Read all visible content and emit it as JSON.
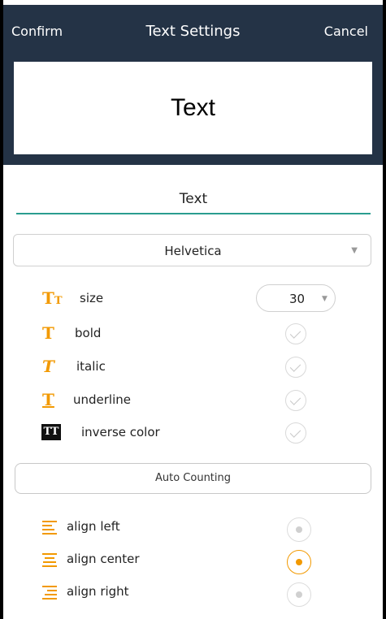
{
  "header": {
    "confirm_label": "Confirm",
    "title": "Text Settings",
    "cancel_label": "Cancel",
    "background_color": "#243346"
  },
  "preview": {
    "text": "Text"
  },
  "text_input": {
    "value": "Text"
  },
  "font_select": {
    "value": "Helvetica"
  },
  "options": {
    "size": {
      "label": "size",
      "value": "30",
      "icon": "text-size-icon"
    },
    "bold": {
      "label": "bold",
      "icon": "bold-icon",
      "checked": false
    },
    "italic": {
      "label": "italic",
      "icon": "italic-icon",
      "checked": false
    },
    "underline": {
      "label": "underline",
      "icon": "underline-icon",
      "checked": false
    },
    "inverse": {
      "label": "inverse color",
      "icon": "inverse-color-icon",
      "checked": false
    }
  },
  "auto_counting": {
    "label": "Auto Counting"
  },
  "alignment": {
    "left": {
      "label": "align left",
      "selected": false
    },
    "center": {
      "label": "align center",
      "selected": true
    },
    "right": {
      "label": "align right",
      "selected": false
    }
  },
  "colors": {
    "accent": "#f29900",
    "underline_teal": "#2a9d8f"
  }
}
